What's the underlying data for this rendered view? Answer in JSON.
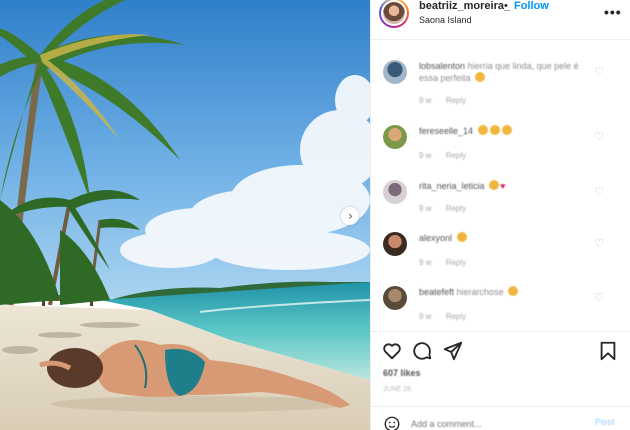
{
  "header": {
    "username": "beatriiz_moreira_",
    "separator": "•",
    "follow_label": "Follow",
    "location": "Saona Island",
    "more_icon": "more-horizontal-icon"
  },
  "photo": {
    "next_icon": "chevron-right-icon"
  },
  "comments": [
    {
      "username": "lobsalenton",
      "text": "hierria que linda, que pele é essa perfeita",
      "emojis": [
        "emoji"
      ],
      "time": "9 w",
      "reply": "Reply"
    },
    {
      "username": "fereseelle_14",
      "text": "",
      "emojis": [
        "emoji",
        "emoji",
        "emoji"
      ],
      "time": "9 w",
      "reply": "Reply"
    },
    {
      "username": "rita_neria_leticia",
      "text": "",
      "emojis": [
        "emoji",
        "heart"
      ],
      "time": "9 w",
      "reply": "Reply"
    },
    {
      "username": "alexyonl",
      "text": "",
      "emojis": [
        "emoji"
      ],
      "time": "9 w",
      "reply": "Reply"
    },
    {
      "username": "beatefeft",
      "text": "hierarchose",
      "emojis": [
        "emoji"
      ],
      "time": "9 w",
      "reply": "Reply"
    }
  ],
  "actions": {
    "like_icon": "heart-icon",
    "comment_icon": "comment-icon",
    "share_icon": "share-icon",
    "save_icon": "bookmark-icon"
  },
  "likes": "607 likes",
  "date": "JUNE 28",
  "add_comment": {
    "placeholder": "Add a comment...",
    "post_label": "Post"
  },
  "colors": {
    "link_blue": "#0095f6",
    "emoji": "#f0b63c",
    "heart": "#e0245e"
  }
}
